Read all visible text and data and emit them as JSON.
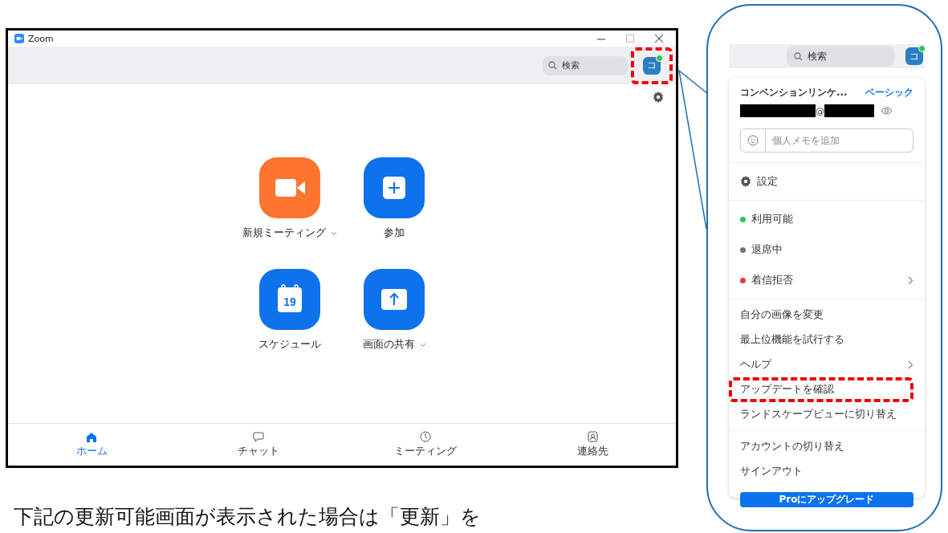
{
  "window": {
    "title": "Zoom",
    "search": {
      "placeholder": "検索"
    },
    "avatar": {
      "initial": "コ",
      "online": true,
      "highlighted": true
    },
    "actions": [
      {
        "label": "新規ミーティング",
        "color": "#ff742e",
        "dropdown": true
      },
      {
        "label": "参加",
        "color": "#0e72ed",
        "dropdown": false
      },
      {
        "label": "スケジュール",
        "color": "#0e72ed",
        "dropdown": false,
        "calendar_day": "19"
      },
      {
        "label": "画面の共有",
        "color": "#0e72ed",
        "dropdown": true
      }
    ],
    "nav": [
      {
        "label": "ホーム",
        "selected": true
      },
      {
        "label": "チャット",
        "selected": false
      },
      {
        "label": "ミーティング",
        "selected": false
      },
      {
        "label": "連絡先",
        "selected": false
      }
    ]
  },
  "callout": {
    "search": {
      "placeholder": "検索"
    },
    "avatar": {
      "initial": "コ",
      "online": true
    },
    "profile": {
      "name": "コンベンションリンケ...",
      "plan": "ベーシック",
      "email_at": "@"
    },
    "note_field": {
      "placeholder": "個人メモを追加"
    },
    "menu_sections": [
      [
        {
          "label": "設定",
          "kind": "settings",
          "submenu": false,
          "highlighted": false
        }
      ],
      [
        {
          "label": "利用可能",
          "kind": "status",
          "color": "#2dc84d",
          "submenu": false,
          "highlighted": false
        },
        {
          "label": "退席中",
          "kind": "status",
          "color": "#747487",
          "submenu": false,
          "highlighted": false
        },
        {
          "label": "着信拒否",
          "kind": "status",
          "color": "#e8384f",
          "submenu": true,
          "highlighted": false
        }
      ],
      [
        {
          "label": "自分の画像を変更",
          "kind": "item",
          "submenu": false,
          "highlighted": false
        },
        {
          "label": "最上位機能を試行する",
          "kind": "item",
          "submenu": false,
          "highlighted": false
        },
        {
          "label": "ヘルプ",
          "kind": "item",
          "submenu": true,
          "highlighted": false
        },
        {
          "label": "アップデートを確認",
          "kind": "item",
          "submenu": false,
          "highlighted": true
        },
        {
          "label": "ランドスケープビューに切り替え",
          "kind": "item",
          "submenu": false,
          "highlighted": false
        }
      ],
      [
        {
          "label": "アカウントの切り替え",
          "kind": "item",
          "submenu": false,
          "highlighted": false
        },
        {
          "label": "サインアウト",
          "kind": "item",
          "submenu": false,
          "highlighted": false
        }
      ]
    ],
    "upgrade_button": "Proにアップグレード"
  },
  "caption": "下記の更新可能画面が表示された場合は「更新」を"
}
